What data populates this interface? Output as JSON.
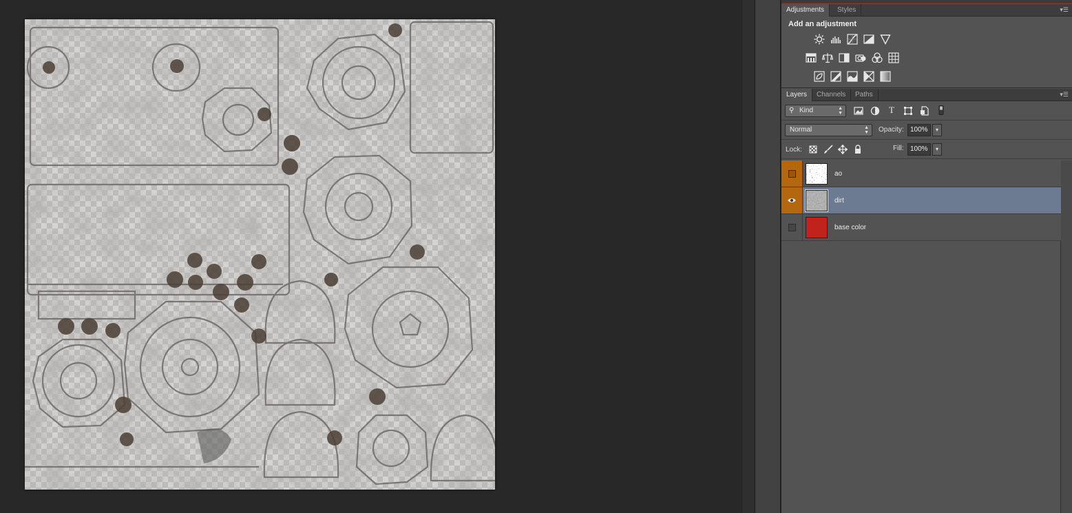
{
  "adjustments_panel": {
    "tabs": [
      {
        "label": "Adjustments",
        "active": true
      },
      {
        "label": "Styles",
        "active": false
      }
    ],
    "title": "Add an adjustment",
    "icon_rows": [
      [
        "brightness-contrast-icon",
        "levels-icon",
        "curves-icon",
        "exposure-icon",
        "vibrance-icon"
      ],
      [
        "hue-saturation-icon",
        "color-balance-icon",
        "black-white-icon",
        "photo-filter-icon",
        "channel-mixer-icon",
        "color-lookup-icon"
      ],
      [
        "invert-icon",
        "posterize-icon",
        "threshold-icon",
        "selective-color-icon",
        "gradient-map-icon"
      ]
    ]
  },
  "layers_panel": {
    "tabs": [
      {
        "label": "Layers",
        "active": true
      },
      {
        "label": "Channels",
        "active": false
      },
      {
        "label": "Paths",
        "active": false
      }
    ],
    "filter": {
      "kind_label": "Kind",
      "icons": [
        "pixel-filter-icon",
        "adjustment-filter-icon",
        "type-filter-icon",
        "shape-filter-icon",
        "smart-object-filter-icon",
        "filter-toggle-icon"
      ]
    },
    "blend_mode": "Normal",
    "opacity_label": "Opacity:",
    "opacity_value": "100%",
    "lock_label": "Lock:",
    "lock_icons": [
      "lock-transparent-icon",
      "lock-brush-icon",
      "lock-move-icon",
      "lock-all-icon"
    ],
    "fill_label": "Fill:",
    "fill_value": "100%",
    "layers": [
      {
        "name": "ao",
        "visible": false,
        "selected": false,
        "vis_highlight": true,
        "thumb": "texture-bw"
      },
      {
        "name": "dirt",
        "visible": true,
        "selected": true,
        "vis_highlight": true,
        "thumb": "texture-gray"
      },
      {
        "name": "base color",
        "visible": false,
        "selected": false,
        "vis_highlight": false,
        "thumb": "solid-red"
      }
    ]
  },
  "colors": {
    "vis_orange": "#b4670f",
    "selected_layer": "#6c7a92",
    "base_color_swatch": "#c0231c"
  }
}
